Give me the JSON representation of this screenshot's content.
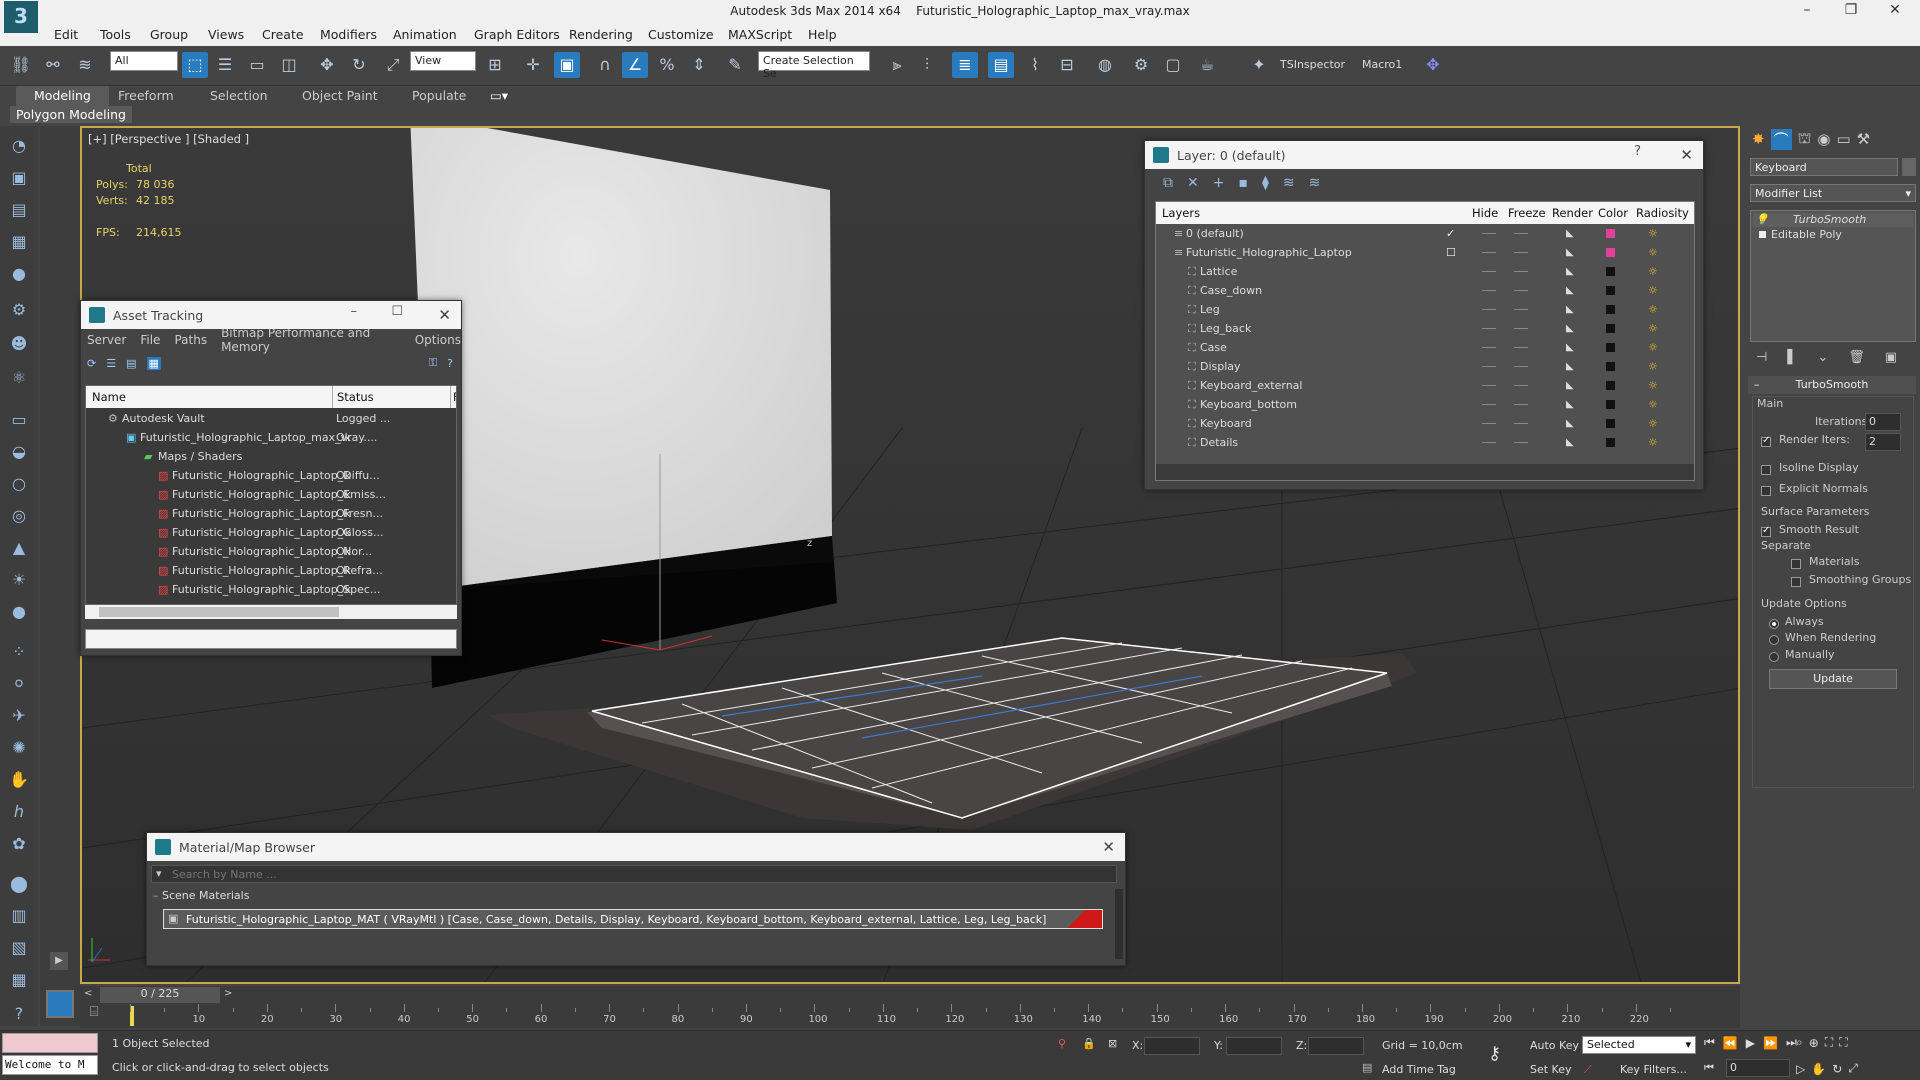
{
  "window": {
    "app_title": "Autodesk 3ds Max  2014 x64",
    "file_title": "Futuristic_Holographic_Laptop_max_vray.max"
  },
  "menu": [
    "Edit",
    "Tools",
    "Group",
    "Views",
    "Create",
    "Modifiers",
    "Animation",
    "Graph Editors",
    "Rendering",
    "Customize",
    "MAXScript",
    "Help"
  ],
  "toolbar": {
    "selection_filter": "All",
    "ref_coord": "View",
    "named_selection": "Create Selection Se",
    "tsinspector": "TSInspector",
    "macro1": "Macro1"
  },
  "ribbon": {
    "tabs": [
      "Modeling",
      "Freeform",
      "Selection",
      "Object Paint",
      "Populate"
    ],
    "active": "Modeling",
    "sub": "Polygon Modeling"
  },
  "viewport": {
    "label": "[+] [Perspective ] [Shaded ]",
    "stats": {
      "total": "Total",
      "polys_label": "Polys:",
      "polys": "78 036",
      "verts_label": "Verts:",
      "verts": "42 185",
      "fps_label": "FPS:",
      "fps": "214,615"
    },
    "axis_label": "z"
  },
  "asset_tracking": {
    "title": "Asset Tracking",
    "menu": [
      "Server",
      "File",
      "Paths",
      "Bitmap Performance and Memory",
      "Options"
    ],
    "columns": [
      "Name",
      "Status",
      "F"
    ],
    "rows": [
      {
        "name": "Autodesk Vault",
        "status": "Logged ..."
      },
      {
        "name": "Futuristic_Holographic_Laptop_max_vray....",
        "status": "Ok"
      },
      {
        "name": "Maps / Shaders",
        "status": ""
      },
      {
        "name": "Futuristic_Holographic_Laptop_Diffu...",
        "status": "Ok"
      },
      {
        "name": "Futuristic_Holographic_Laptop_Emiss...",
        "status": "Ok"
      },
      {
        "name": "Futuristic_Holographic_Laptop_Fresn...",
        "status": "Ok"
      },
      {
        "name": "Futuristic_Holographic_Laptop_Gloss...",
        "status": "Ok"
      },
      {
        "name": "Futuristic_Holographic_Laptop_Nor...",
        "status": "Ok"
      },
      {
        "name": "Futuristic_Holographic_Laptop_Refra...",
        "status": "Ok"
      },
      {
        "name": "Futuristic_Holographic_Laptop_Spec...",
        "status": "Ok"
      }
    ]
  },
  "layer_manager": {
    "title": "Layer: 0 (default)",
    "help": "?",
    "columns": [
      "Layers",
      "Hide",
      "Freeze",
      "Render",
      "Color",
      "Radiosity"
    ],
    "rows": [
      {
        "name": "0 (default)",
        "color": "#e0409a"
      },
      {
        "name": "Futuristic_Holographic_Laptop",
        "color": "#e0409a"
      },
      {
        "name": "Lattice",
        "color": "#111111"
      },
      {
        "name": "Case_down",
        "color": "#111111"
      },
      {
        "name": "Leg",
        "color": "#111111"
      },
      {
        "name": "Leg_back",
        "color": "#111111"
      },
      {
        "name": "Case",
        "color": "#111111"
      },
      {
        "name": "Display",
        "color": "#111111"
      },
      {
        "name": "Keyboard_external",
        "color": "#111111"
      },
      {
        "name": "Keyboard_bottom",
        "color": "#111111"
      },
      {
        "name": "Keyboard",
        "color": "#111111"
      },
      {
        "name": "Details",
        "color": "#111111"
      }
    ]
  },
  "material_browser": {
    "title": "Material/Map Browser",
    "search_placeholder": "Search by Name ...",
    "section": "Scene Materials",
    "item": "Futuristic_Holographic_Laptop_MAT ( VRayMtl ) [Case, Case_down, Details, Display, Keyboard, Keyboard_bottom, Keyboard_external, Lattice, Leg, Leg_back]"
  },
  "command_panel": {
    "object_name": "Keyboard",
    "modifier_list": "Modifier List",
    "stack": [
      "TurboSmooth",
      "Editable Poly"
    ],
    "rollout_title": "TurboSmooth",
    "main_label": "Main",
    "iterations_label": "Iterations:",
    "iterations": "0",
    "render_iters_label": "Render Iters:",
    "render_iters": "2",
    "isoline": "Isoline Display",
    "explicit_normals": "Explicit Normals",
    "surface_params": "Surface Parameters",
    "smooth_result": "Smooth Result",
    "separate": "Separate",
    "materials": "Materials",
    "smoothing_groups": "Smoothing Groups",
    "update_options": "Update Options",
    "always": "Always",
    "when_rendering": "When Rendering",
    "manually": "Manually",
    "update_btn": "Update"
  },
  "timeline": {
    "frame": "0 / 225",
    "ticks": [
      "10",
      "20",
      "30",
      "40",
      "50",
      "60",
      "70",
      "80",
      "90",
      "100",
      "110",
      "120",
      "130",
      "140",
      "150",
      "160",
      "170",
      "180",
      "190",
      "200",
      "210",
      "220"
    ]
  },
  "status": {
    "welcome": "Welcome to M",
    "selected": "1 Object Selected",
    "prompt": "Click or click-and-drag to select objects",
    "x_label": "X:",
    "y_label": "Y:",
    "z_label": "Z:",
    "grid": "Grid = 10,0cm",
    "add_time_tag": "Add Time Tag",
    "auto_key": "Auto Key",
    "set_key": "Set Key",
    "key_mode": "Selected",
    "key_filters": "Key Filters...",
    "frame_field": "0"
  }
}
